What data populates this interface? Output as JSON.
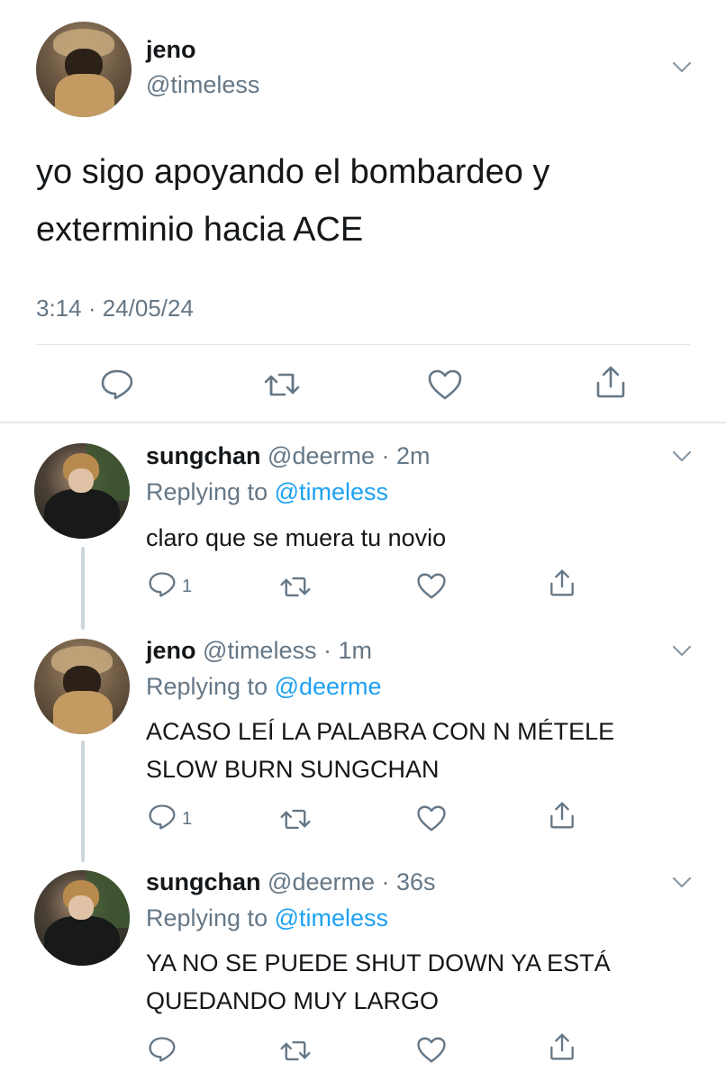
{
  "main_tweet": {
    "name": "jeno",
    "handle": "@timeless",
    "text_line1": "yo sigo apoyando el bombardeo y",
    "text_line2": "exterminio hacia ACE",
    "timestamp": "3:14 · 24/05/24"
  },
  "replies": [
    {
      "name": "sungchan",
      "handle_time": "@deerme · 2m",
      "replying_prefix": "Replying to",
      "replying_to": "@timeless",
      "text_lines": [
        "claro que se muera tu novio"
      ],
      "reply_count": "1"
    },
    {
      "name": "jeno",
      "handle_time": "@timeless · 1m",
      "replying_prefix": "Replying to",
      "replying_to": "@deerme",
      "text_lines": [
        "ACASO LEÍ LA PALABRA CON N MÉTELE",
        "SLOW BURN SUNGCHAN"
      ],
      "reply_count": "1"
    },
    {
      "name": "sungchan",
      "handle_time": "@deerme · 36s",
      "replying_prefix": "Replying to",
      "replying_to": "@timeless",
      "text_lines": [
        "YA NO SE PUEDE SHUT DOWN YA ESTÁ",
        "QUEDANDO MUY LARGO"
      ],
      "reply_count": ""
    }
  ],
  "colors": {
    "link": "#1da1f2",
    "secondary": "#657786",
    "divider": "#e1e8ed",
    "thread_line": "#ccd6dd"
  },
  "icons": [
    "reply-icon",
    "retweet-icon",
    "like-icon",
    "share-icon",
    "chevron-down-icon"
  ]
}
